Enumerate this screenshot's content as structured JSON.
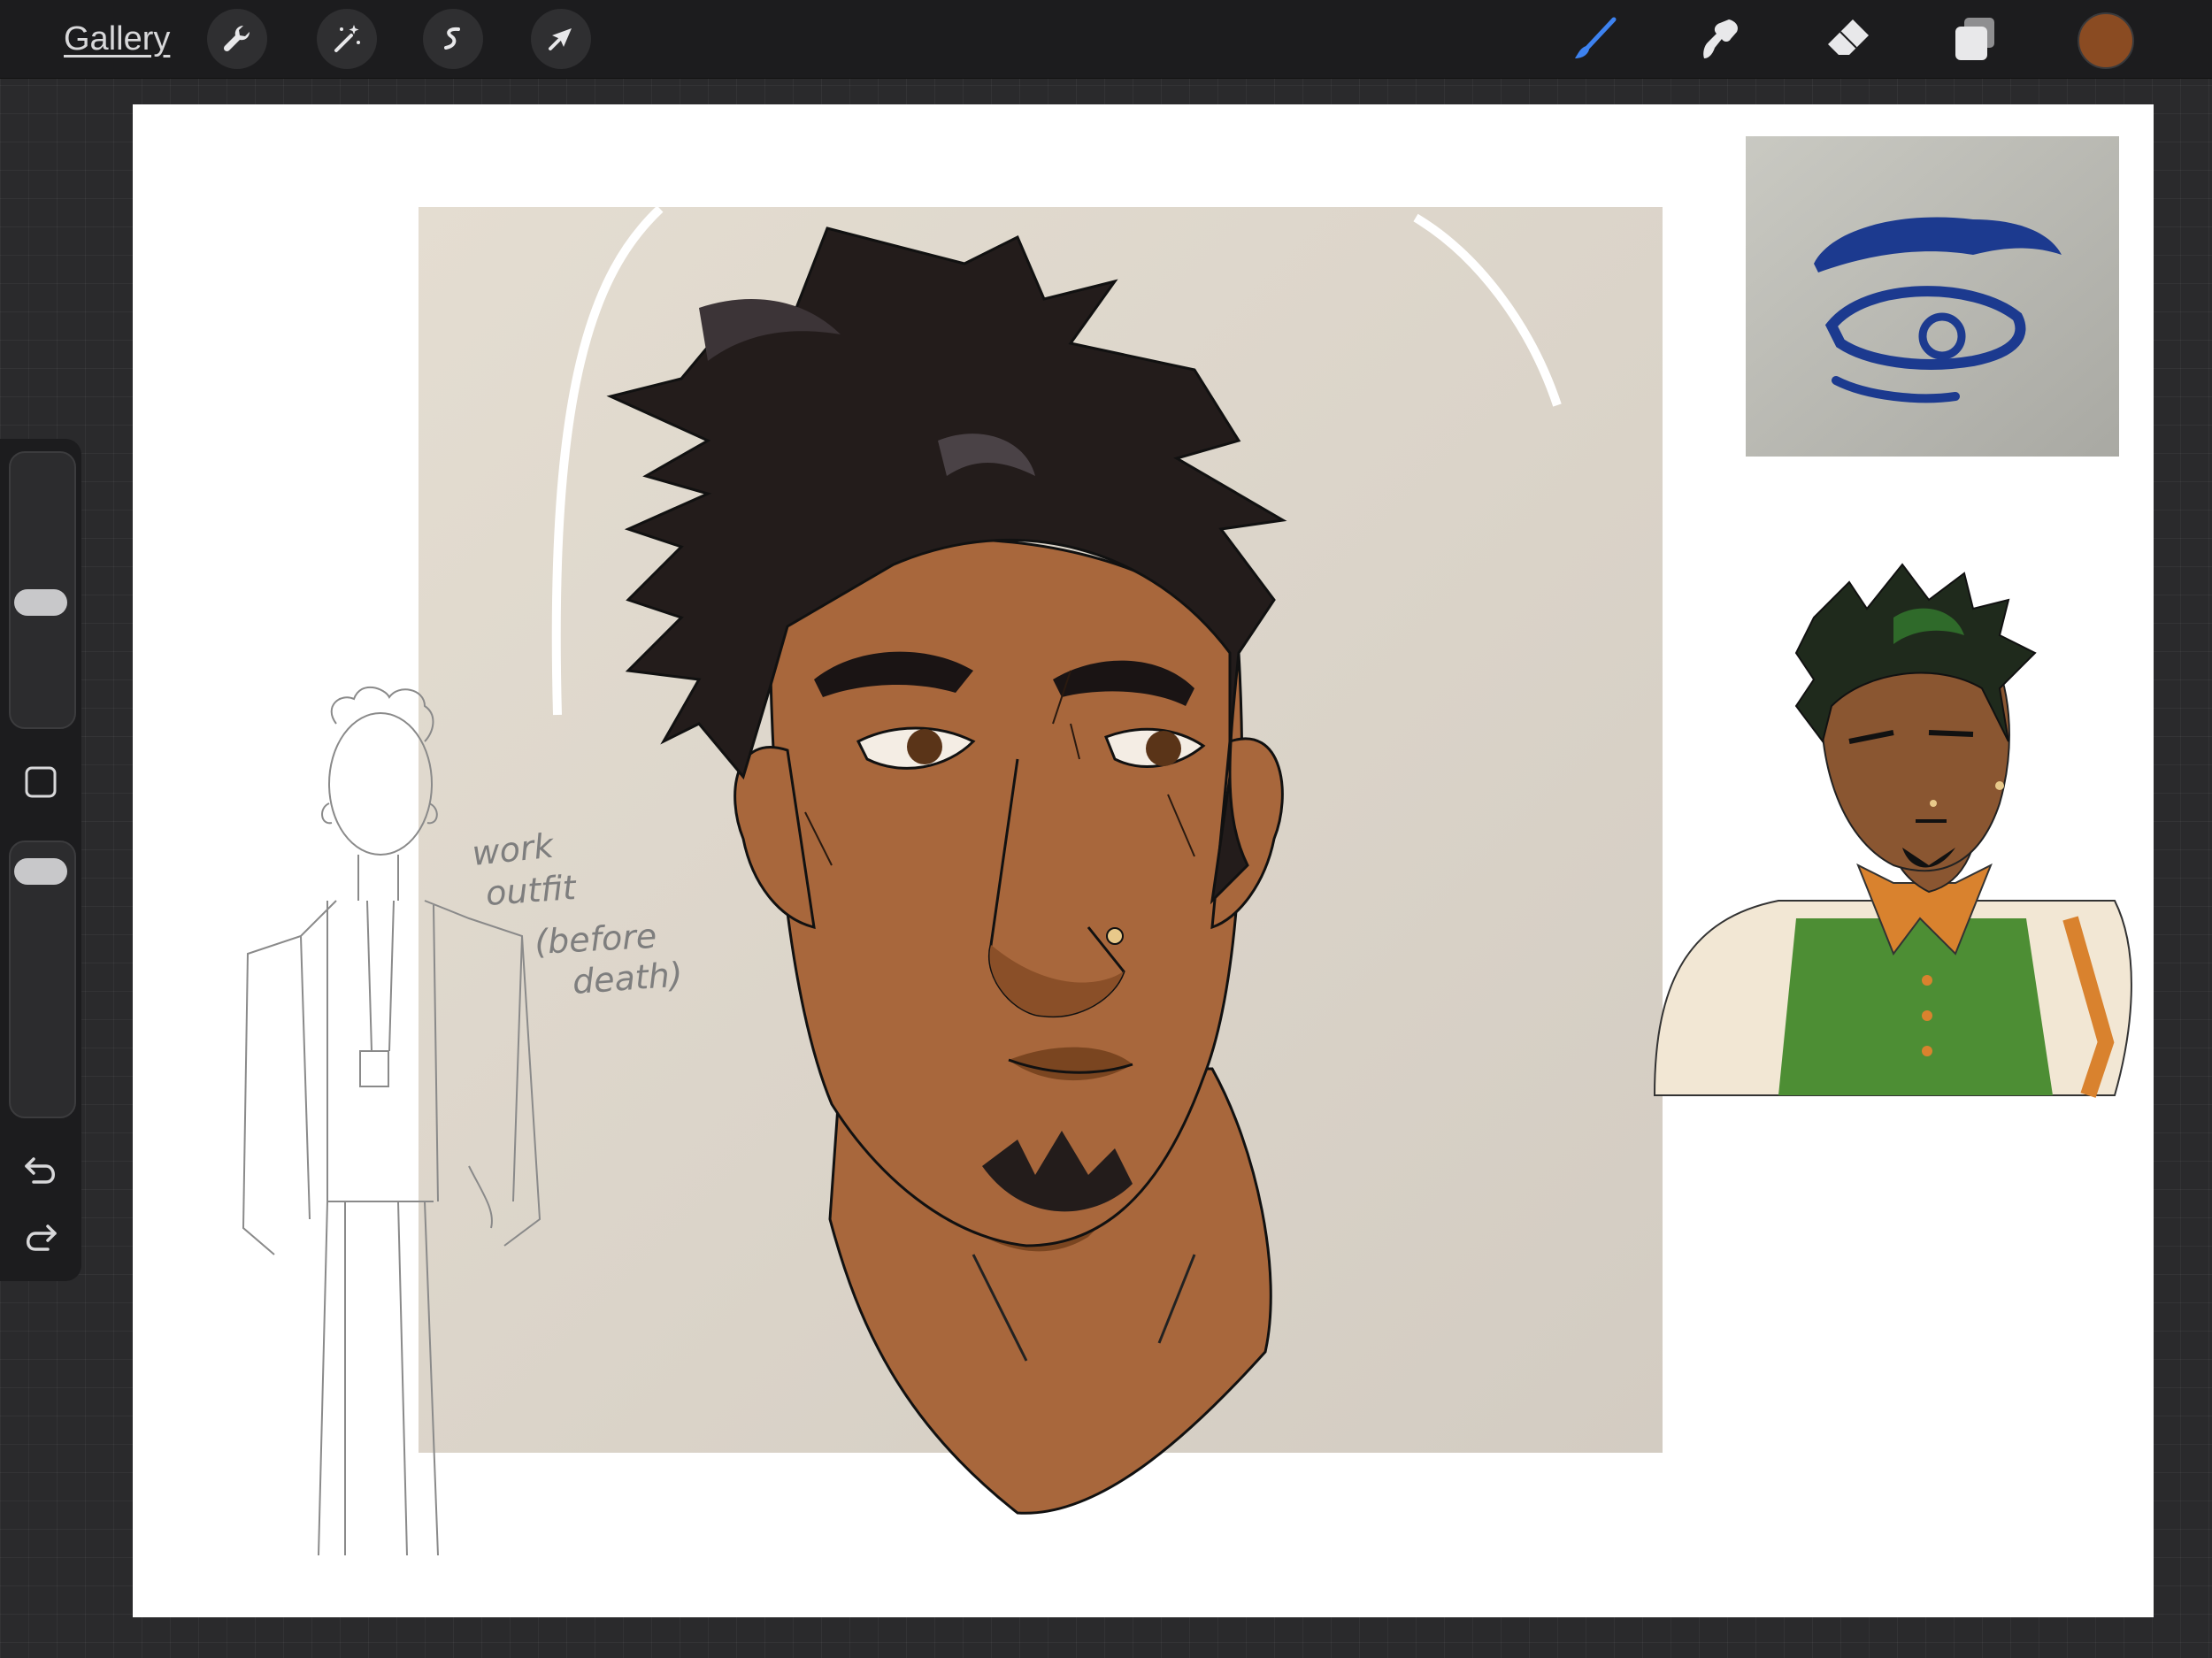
{
  "topbar": {
    "gallery_label": "Gallery",
    "left_tools": [
      "wrench-icon",
      "magic-wand-icon",
      "selection-icon",
      "transform-arrow-icon"
    ],
    "right_tools": [
      "brush-icon",
      "smudge-icon",
      "eraser-icon",
      "layers-icon"
    ],
    "active_tool": "brush-icon",
    "current_color": "#8a4b22"
  },
  "sidebar": {
    "size_slider_level": 0.45,
    "opacity_slider_level": 0.95,
    "modify_button": "square-icon",
    "undo": "undo-icon",
    "redo": "redo-icon"
  },
  "canvas": {
    "background": "#ffffff",
    "sketch_note_lines": [
      "work",
      "outfit",
      "(before",
      "death)"
    ]
  },
  "colors": {
    "skin": "#a8673c",
    "skin_shadow": "#7a4520",
    "hair": "#231c1b",
    "paper": "#ddd6cc",
    "ink_blue": "#1c3a8f",
    "shirt_green": "#4d8e34",
    "collar_orange": "#d9822e"
  }
}
